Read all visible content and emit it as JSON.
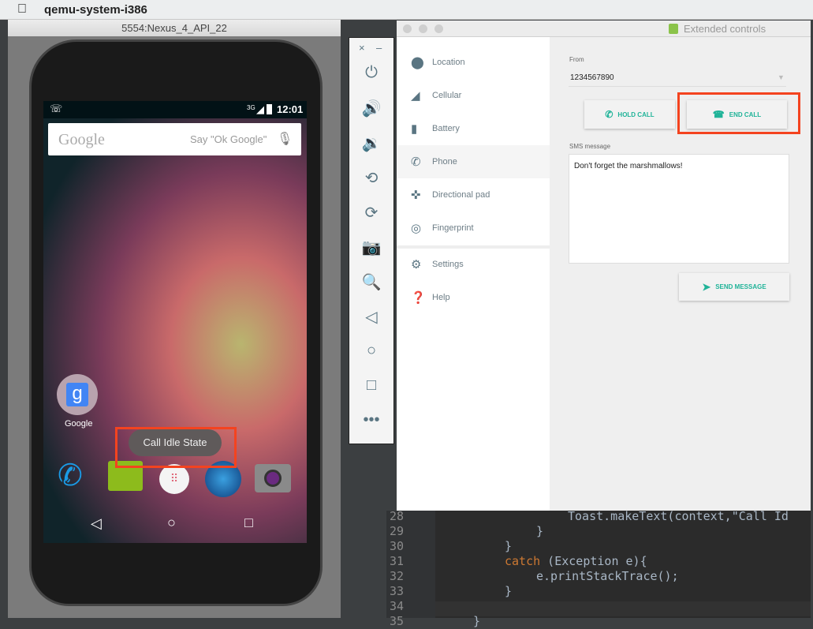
{
  "menubar": {
    "app_name": "qemu-system-i386"
  },
  "emulator": {
    "title": "5554:Nexus_4_API_22",
    "status": {
      "time": "12:01",
      "network": "3G"
    },
    "search": {
      "logo": "Google",
      "hint": "Say \"Ok Google\""
    },
    "home_app": "Google",
    "toast": "Call Idle State",
    "dock": [
      "phone-icon",
      "messaging-icon",
      "app-drawer-icon",
      "browser-icon",
      "camera-icon"
    ]
  },
  "toolbar": {
    "close": "×",
    "minimize": "–"
  },
  "extended": {
    "title": "Extended controls",
    "sidebar": [
      {
        "label": "Location",
        "icon": "location-icon"
      },
      {
        "label": "Cellular",
        "icon": "cellular-icon"
      },
      {
        "label": "Battery",
        "icon": "battery-icon"
      },
      {
        "label": "Phone",
        "icon": "phone-icon",
        "active": true
      },
      {
        "label": "Directional pad",
        "icon": "dpad-icon"
      },
      {
        "label": "Fingerprint",
        "icon": "fingerprint-icon"
      },
      {
        "label": "Settings",
        "icon": "gear-icon"
      },
      {
        "label": "Help",
        "icon": "help-icon"
      }
    ],
    "from_label": "From",
    "from_value": "1234567890",
    "hold_call": "HOLD CALL",
    "end_call": "END CALL",
    "sms_label": "SMS message",
    "sms_value": "Don't forget the marshmallows!",
    "send": "SEND MESSAGE",
    "accent": "#1fb398"
  },
  "code": {
    "lines": [
      {
        "n": "28",
        "text": "            Toast.makeText(context,\"Call Id"
      },
      {
        "n": "29",
        "text": "        }"
      },
      {
        "n": "30",
        "text": "    }"
      },
      {
        "n": "31",
        "kw": "catch",
        "text": " (Exception e){"
      },
      {
        "n": "32",
        "text": "        e.printStackTrace();"
      },
      {
        "n": "33",
        "text": "    }"
      },
      {
        "n": "34",
        "text": ""
      },
      {
        "n": "35",
        "text": "}"
      }
    ]
  }
}
